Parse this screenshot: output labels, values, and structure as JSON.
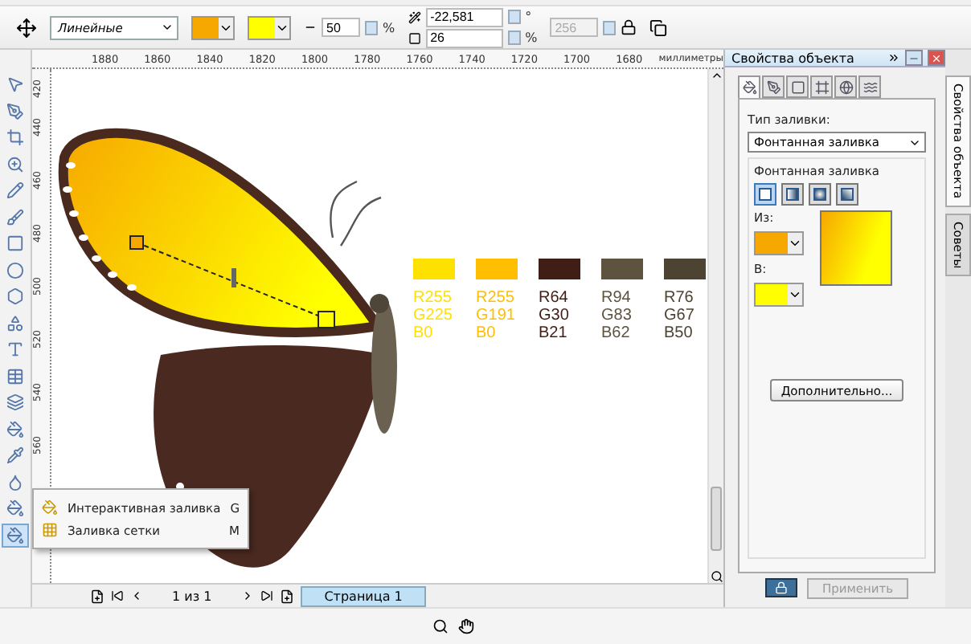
{
  "property_bar": {
    "fill_type": "Линейные",
    "color_pickers": [
      {
        "color": "#f7a800"
      },
      {
        "color": "#ffff00"
      }
    ],
    "midpoint": "50",
    "midpoint_unit": "%",
    "angle": "-22,581",
    "angle_unit": "°",
    "edge_pad": "26",
    "edge_pad_unit": "%",
    "steps": "256",
    "steps_disabled": true
  },
  "ruler": {
    "x_labels": [
      "1880",
      "1860",
      "1840",
      "1820",
      "1800",
      "1780",
      "1760",
      "1740",
      "1720",
      "1700",
      "1680"
    ],
    "unit": "миллиметры",
    "y_labels": [
      "420",
      "440",
      "460",
      "480",
      "500",
      "520",
      "540",
      "560"
    ]
  },
  "tools": [
    {
      "selected": false
    },
    {
      "selected": false
    },
    {
      "selected": false
    },
    {
      "selected": false
    },
    {
      "selected": false
    },
    {
      "selected": false
    },
    {
      "selected": false
    },
    {
      "selected": false
    },
    {
      "selected": false
    },
    {
      "selected": false
    },
    {
      "selected": false
    },
    {
      "selected": false
    },
    {
      "selected": false
    },
    {
      "selected": false
    },
    {
      "selected": false
    },
    {
      "selected": false
    },
    {
      "selected": false
    },
    {
      "selected": true
    }
  ],
  "swatches": [
    {
      "color": "#ffe100",
      "r": "R255",
      "g": "G225",
      "b": "B0"
    },
    {
      "color": "#ffbf00",
      "r": "R255",
      "g": "G191",
      "b": "B0"
    },
    {
      "color": "#401e15",
      "r": "R64",
      "g": "G30",
      "b": "B21"
    },
    {
      "color": "#5e533e",
      "r": "R94",
      "g": "G83",
      "b": "B62"
    },
    {
      "color": "#4c4332",
      "r": "R76",
      "g": "G67",
      "b": "B50"
    }
  ],
  "flyout_menu": [
    {
      "kind": "interactive",
      "label": "Интерактивная заливка",
      "shortcut": "G"
    },
    {
      "kind": "mesh",
      "label": "Заливка сетки",
      "shortcut": "M"
    }
  ],
  "page_nav": {
    "counter": "1 из 1",
    "tabs": [
      {
        "label": "Страница 1",
        "selected": true
      }
    ]
  },
  "docker": {
    "title": "Свойства объекта",
    "tabs": [
      {
        "kind": "fill",
        "selected": true
      },
      {
        "kind": "outline",
        "selected": false
      },
      {
        "kind": "frame",
        "selected": false
      },
      {
        "kind": "summary",
        "selected": false
      },
      {
        "kind": "internet",
        "selected": false
      },
      {
        "kind": "curve",
        "selected": false
      }
    ],
    "fill_type_label": "Тип заливки:",
    "fill_type": "Фонтанная заливка",
    "group_title": "Фонтанная заливка",
    "fountain_types": [
      {
        "selected": true
      },
      {
        "selected": false
      },
      {
        "selected": false
      },
      {
        "selected": false
      }
    ],
    "color_pickers": [
      {
        "label": "Из:",
        "color": "#f7a800"
      },
      {
        "label": "В:",
        "color": "#ffff00"
      }
    ],
    "more_button": "Дополнительно...",
    "apply_button": {
      "label": "Применить",
      "disabled": true
    }
  },
  "side_tabs": [
    {
      "label": "Свойства объекта",
      "selected": true
    },
    {
      "label": "Советы",
      "selected": false
    }
  ]
}
